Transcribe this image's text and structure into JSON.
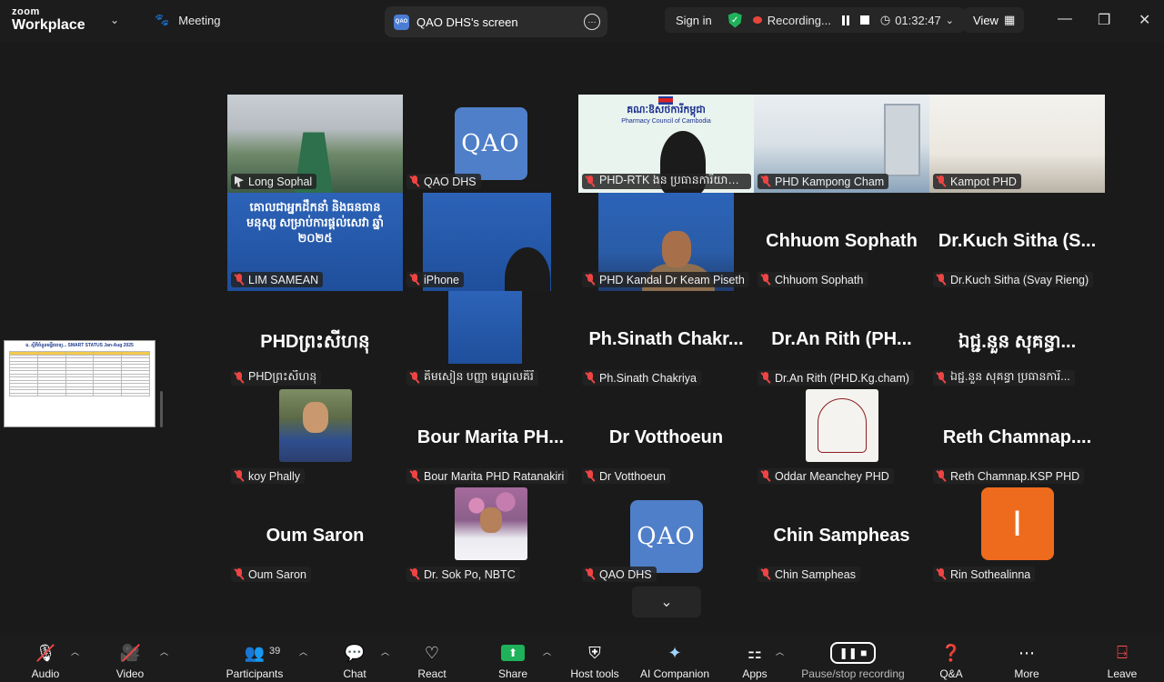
{
  "topbar": {
    "brand_line1": "zoom",
    "brand_line2": "Workplace",
    "meeting_label": "Meeting",
    "share_tab_logo": "QAO",
    "share_tab_label": "QAO DHS's screen",
    "sign_in": "Sign in",
    "recording_label": "Recording...",
    "timer": "01:32:47",
    "view_label": "View"
  },
  "slide_thumb": {
    "title": "ឧ. ស្ថិតិចំនួនមន្ទីរពេទ្យ... SMART STATUS Jan-Aug 2025"
  },
  "participants": [
    {
      "label": "Long Sophal",
      "big": "",
      "kind": "room-photo",
      "active": true,
      "host": true
    },
    {
      "label": "QAO DHS",
      "big": "",
      "kind": "qao-logo"
    },
    {
      "label": "PHD-RTK ងន ប្រធានការិយាល័យ...",
      "big": "",
      "kind": "pharmacy"
    },
    {
      "label": "PHD Kampong Cham",
      "big": "",
      "kind": "office1"
    },
    {
      "label": "Kampot PHD",
      "big": "",
      "kind": "office2"
    },
    {
      "label": "LIM SAMEAN",
      "big": "",
      "kind": "slide"
    },
    {
      "label": "iPhone",
      "big": "",
      "kind": "slide-hand"
    },
    {
      "label": "PHD Kandal Dr Keam Piseth",
      "big": "",
      "kind": "kandal"
    },
    {
      "label": "Chhuom Sophath",
      "big": "Chhuom Sophath",
      "kind": "name"
    },
    {
      "label": "Dr.Kuch Sitha (Svay Rieng)",
      "big": "Dr.Kuch Sitha (S...",
      "kind": "name"
    },
    {
      "label": "PHDព្រះសីហនុ",
      "big": "PHDព្រះសីហនុ",
      "kind": "name"
    },
    {
      "label": "គីមសៀន បញ្ញា មណ្ឌលគិរី",
      "big": "",
      "kind": "small-slide"
    },
    {
      "label": "Ph.Sinath Chakriya",
      "big": "Ph.Sinath Chakr...",
      "kind": "name"
    },
    {
      "label": "Dr.An Rith (PHD.Kg.cham)",
      "big": "Dr.An Rith (PH...",
      "kind": "name"
    },
    {
      "label": "ឯជ្ជ.នួន សុគន្ធា ប្រធានការិ...",
      "big": "ឯជ្ជ.នួន សុគន្ធា...",
      "kind": "name"
    },
    {
      "label": "koy Phally",
      "big": "",
      "kind": "person"
    },
    {
      "label": "Bour Marita PHD Ratanakiri",
      "big": "Bour Marita PH...",
      "kind": "name"
    },
    {
      "label": "Dr Votthoeun",
      "big": "Dr Votthoeun",
      "kind": "name"
    },
    {
      "label": "Oddar Meanchey PHD",
      "big": "",
      "kind": "seal"
    },
    {
      "label": "Reth Chamnap.KSP PHD",
      "big": "Reth Chamnap....",
      "kind": "name"
    },
    {
      "label": "Oum Saron",
      "big": "Oum Saron",
      "kind": "name"
    },
    {
      "label": "Dr. Sok Po, NBTC",
      "big": "",
      "kind": "flowers"
    },
    {
      "label": "QAO DHS",
      "big": "",
      "kind": "qao-logo"
    },
    {
      "label": "Chin Sampheas",
      "big": "Chin Sampheas",
      "kind": "name"
    },
    {
      "label": "Rin Sothealinna",
      "big": "",
      "kind": "orange"
    }
  ],
  "pharmacy_tile": {
    "title_kh": "គណៈឱសថការីកម្ពុជា",
    "title_en": "Pharmacy Council of Cambodia"
  },
  "slide_text": "គោលជាអ្នកដឹកនាំ និងធនធានមនុស្ស សម្រាប់ការផ្តល់សេវា ឆ្នាំ ២០២៥",
  "qao_logo_text": "QAO",
  "orange_letter": "I",
  "toolbar": {
    "audio": "Audio",
    "video": "Video",
    "participants": "Participants",
    "participants_count": "39",
    "chat": "Chat",
    "react": "React",
    "share": "Share",
    "host_tools": "Host tools",
    "ai_companion": "AI Companion",
    "apps": "Apps",
    "pause_stop_recording": "Pause/stop recording",
    "qa": "Q&A",
    "more": "More",
    "leave": "Leave"
  },
  "colors": {
    "active_speaker": "#2fd06d",
    "recording": "#e8453c",
    "share_green": "#1fb25a",
    "qao_blue": "#4f7fc9",
    "leave_red": "#ff4b4b"
  }
}
